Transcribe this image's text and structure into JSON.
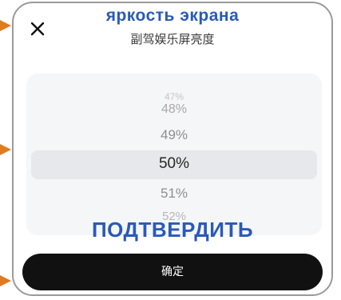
{
  "dialog": {
    "title": "副驾娱乐屏亮度",
    "title_overlay": "яркость экрана",
    "close_icon": "close-icon",
    "confirm_label": "确定",
    "confirm_overlay": "ПОДТВЕРДИТЬ"
  },
  "picker": {
    "selected": "50%",
    "options": [
      "47%",
      "48%",
      "49%",
      "50%",
      "51%",
      "52%"
    ]
  },
  "colors": {
    "accent_overlay": "#2a5ab8",
    "pointer": "#e07b1f",
    "button_bg": "#111111"
  }
}
